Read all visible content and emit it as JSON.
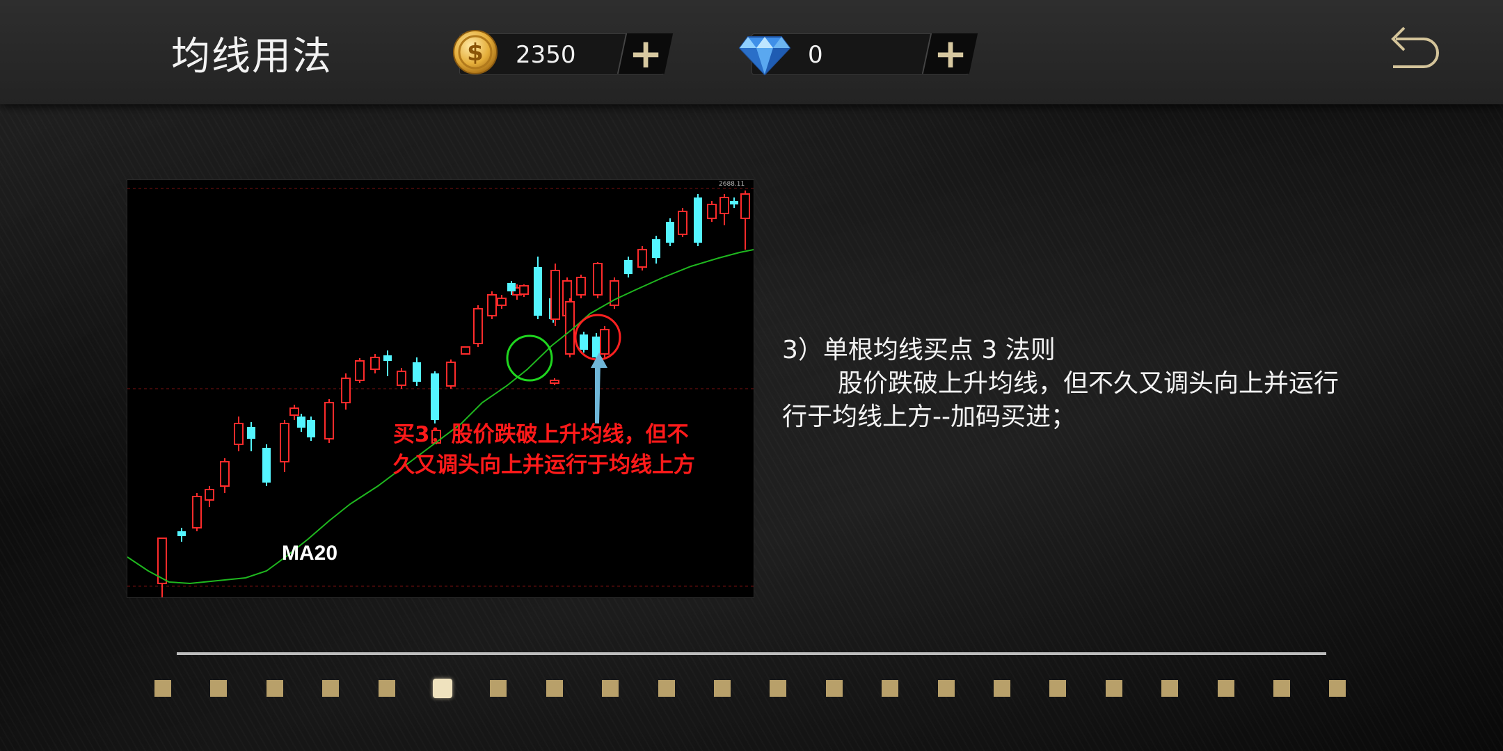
{
  "header": {
    "title": "均线用法",
    "coins": {
      "value": "2350",
      "plus": "+"
    },
    "gems": {
      "value": "0",
      "plus": "+"
    }
  },
  "chart": {
    "ma_label": "MA20",
    "annotation_line1": "买3：股价跌破上升均线，但不",
    "annotation_line2": "久又调头向上并运行于均线上方",
    "corner_value": "2688.11"
  },
  "description": {
    "heading": "3）单根均线买点 3 法则",
    "line1": "股价跌破上升均线，但不久又调头向上并运行",
    "line2": "行于均线上方--加码买进；"
  },
  "pager": {
    "total": 22,
    "current_index": 5
  },
  "colors": {
    "up_candle": "#ff2b2b",
    "down_candle": "#54f5ff",
    "ma_line": "#1fb81f",
    "annotation": "#ff1a1a",
    "dot": "#b8a06a",
    "dot_active": "#efe2be"
  },
  "chart_data": {
    "type": "candlestick",
    "series": [
      {
        "name": "MA20"
      }
    ],
    "annotations": [
      "买3：股价跌破上升均线，但不久又调头向上并运行于均线上方"
    ]
  }
}
